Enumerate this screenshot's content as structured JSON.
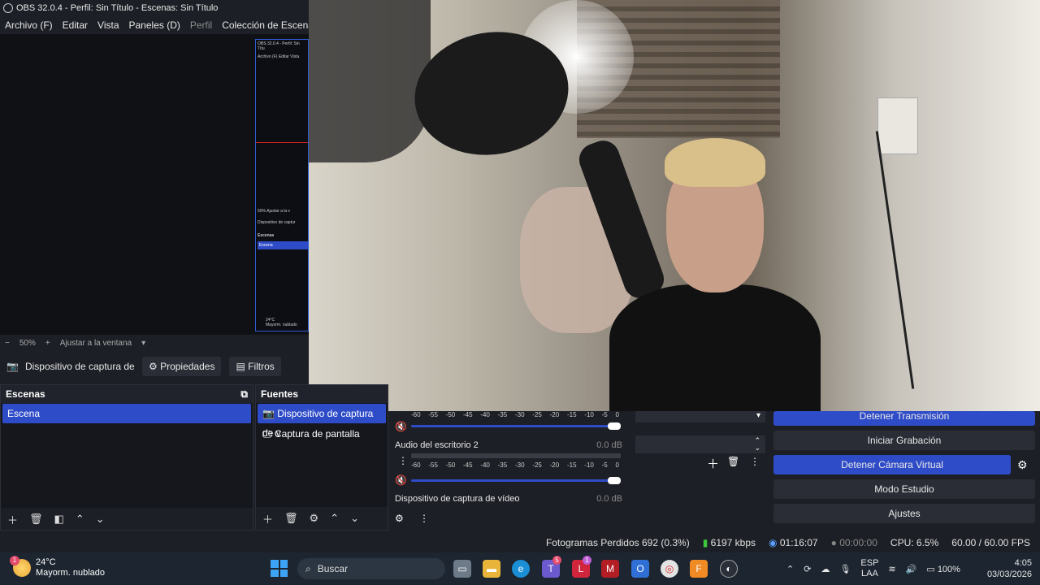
{
  "window": {
    "title": "OBS 32.0.4 - Perfil: Sin Título - Escenas: Sin Título"
  },
  "menu": [
    "Archivo (F)",
    "Editar",
    "Vista",
    "Paneles (D)",
    "Perfil",
    "Colección de Escenas"
  ],
  "nested_preview": {
    "title": "OBS 32.0.4 - Perfil: Sin Títu",
    "menu": "Archivo (F)   Editar   Vista",
    "zoom": "50%",
    "fit": "Ajustar a la v",
    "source": "Dispositivo de captur",
    "scenes_title": "Escenas",
    "scene": "Escena",
    "weather_temp": "24°C",
    "weather_desc": "Mayorm. nublado"
  },
  "zoombar": {
    "minus": "−",
    "zoom": "50%",
    "plus": "+",
    "fit_label": "Ajustar a la ventana"
  },
  "source_toolbar": {
    "source_name": "Dispositivo de captura de v",
    "properties": "Propiedades",
    "filters": "Filtros"
  },
  "scenes": {
    "title": "Escenas",
    "items": [
      "Escena"
    ],
    "selected_index": 0
  },
  "sources": {
    "title": "Fuentes",
    "items": [
      "Dispositivo de captura de v",
      "Captura de pantalla"
    ],
    "selected_index": 0
  },
  "mixer": {
    "ticks": [
      "-60",
      "-55",
      "-50",
      "-45",
      "-40",
      "-35",
      "-30",
      "-25",
      "-20",
      "-15",
      "-10",
      "-5",
      "0"
    ],
    "channels": [
      {
        "name": "Audio del escritorio 2",
        "db": "0.0 dB"
      },
      {
        "name": "Dispositivo de captura de vídeo",
        "db": "0.0 dB"
      }
    ]
  },
  "controls": {
    "stop_stream": "Detener Transmisión",
    "start_record": "Iniciar Grabación",
    "stop_virtualcam": "Detener Cámara Virtual",
    "studio_mode": "Modo Estudio",
    "settings": "Ajustes"
  },
  "status": {
    "dropped_frames": "Fotogramas Perdidos 692 (0.3%)",
    "bitrate": "6197 kbps",
    "stream_time": "01:16:07",
    "record_time": "00:00:00",
    "cpu": "CPU: 6.5%",
    "fps": "60.00 / 60.00 FPS"
  },
  "taskbar": {
    "weather_temp": "24°C",
    "weather_desc": "Mayorm. nublado",
    "weather_badge": "1",
    "search_placeholder": "Buscar",
    "lang_top": "ESP",
    "lang_bottom": "LAA",
    "battery": "100%",
    "time": "4:05",
    "date": "03/03/2026",
    "teams_badge": "5",
    "mail_badge": "1"
  },
  "colors": {
    "accent": "#2f4cc8",
    "bg": "#1d1f26",
    "green": "#3cc73c"
  }
}
